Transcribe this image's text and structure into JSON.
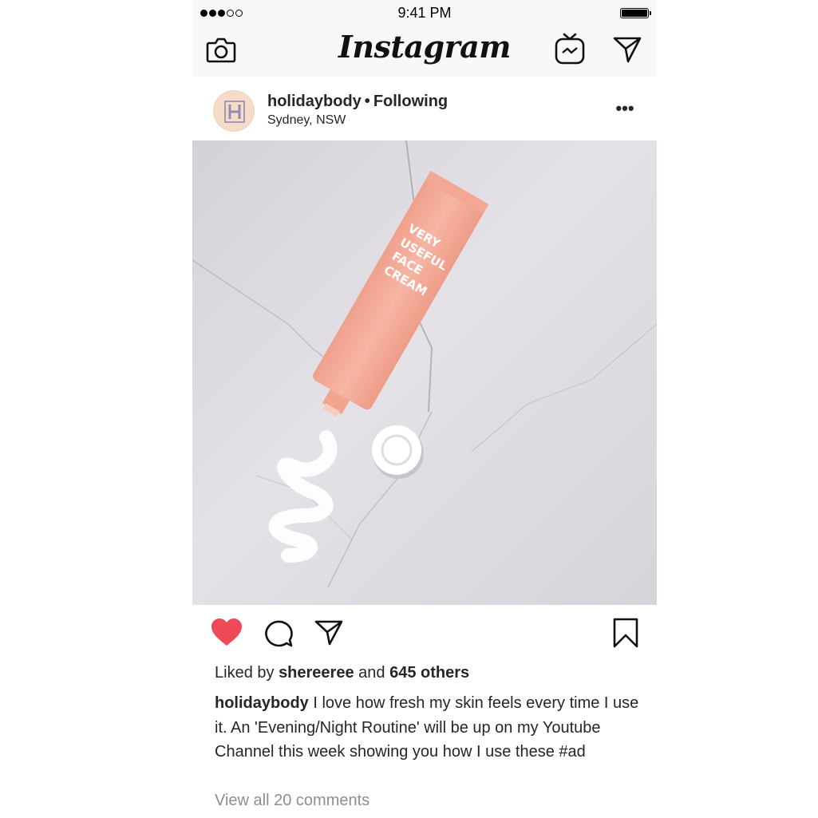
{
  "status_bar": {
    "time": "9:41 PM",
    "signal_bars": 5,
    "signal_filled": 3
  },
  "nav": {
    "wordmark": "Instagram",
    "icons": [
      "camera-icon",
      "igtv-icon",
      "direct-message-icon"
    ]
  },
  "post": {
    "avatar_letter": "H",
    "username": "holidaybody",
    "separator": "•",
    "follow_status": "Following",
    "location": "Sydney, NSW",
    "more_label": "•••",
    "image": {
      "product_text": [
        "VERY",
        "USEFUL",
        "FACE",
        "CREAM"
      ],
      "tube_color": "#f3a896",
      "cap_color": "#ffffff",
      "background_color": "#d8d6dc"
    },
    "liked": true,
    "like_color": "#ed4956",
    "likes": {
      "prefix": "Liked by",
      "user": "shereeree",
      "conjunction": "and",
      "others": "645 others"
    },
    "caption": {
      "username": "holidaybody",
      "text": "I love how fresh my skin feels every time I use it. An 'Evening/Night Routine' will be up on my Youtube Channel this week showing you how I use these #ad"
    },
    "view_comments": "View all 20 comments"
  }
}
